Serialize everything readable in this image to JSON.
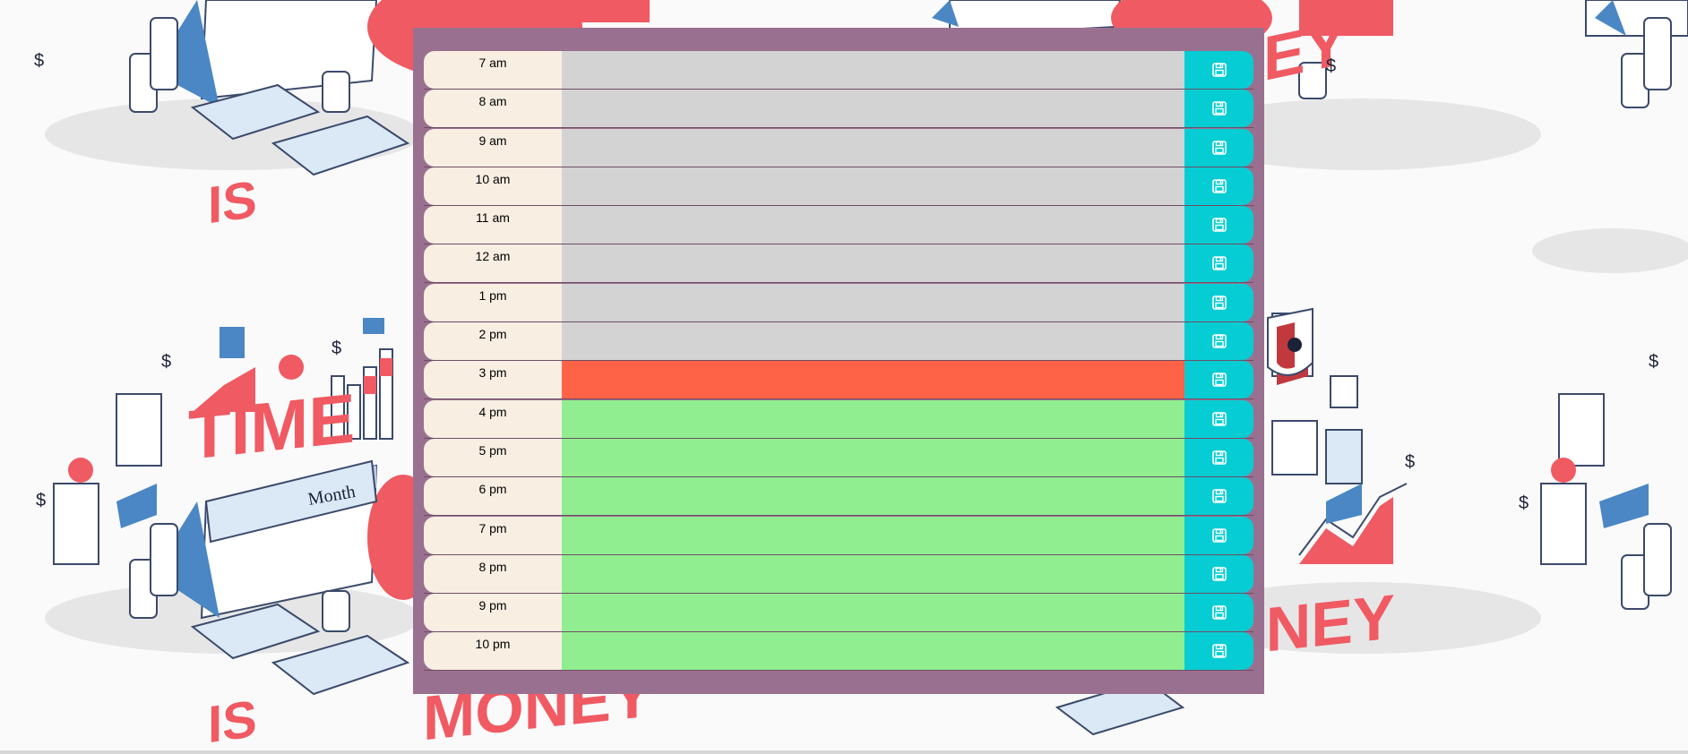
{
  "planner": {
    "rows": [
      {
        "hour": "7 am",
        "text": "",
        "state": "past"
      },
      {
        "hour": "8 am",
        "text": "",
        "state": "past"
      },
      {
        "hour": "9 am",
        "text": "",
        "state": "past"
      },
      {
        "hour": "10 am",
        "text": "",
        "state": "past"
      },
      {
        "hour": "11 am",
        "text": "",
        "state": "past"
      },
      {
        "hour": "12 am",
        "text": "",
        "state": "past"
      },
      {
        "hour": "1 pm",
        "text": "",
        "state": "past"
      },
      {
        "hour": "2 pm",
        "text": "",
        "state": "past"
      },
      {
        "hour": "3 pm",
        "text": "",
        "state": "present"
      },
      {
        "hour": "4 pm",
        "text": "",
        "state": "future"
      },
      {
        "hour": "5 pm",
        "text": "",
        "state": "future"
      },
      {
        "hour": "6 pm",
        "text": "",
        "state": "future"
      },
      {
        "hour": "7 pm",
        "text": "",
        "state": "future"
      },
      {
        "hour": "8 pm",
        "text": "",
        "state": "future"
      },
      {
        "hour": "9 pm",
        "text": "",
        "state": "future"
      },
      {
        "hour": "10 pm",
        "text": "",
        "state": "future"
      }
    ],
    "save_icon": "save-icon"
  },
  "wallpaper": {
    "texts": [
      "IS",
      "TIME",
      "MONEY",
      "Month"
    ]
  },
  "colors": {
    "frame": "#9a7090",
    "hour_bg": "#f8eee2",
    "past": "#d3d3d3",
    "present": "#ff6347",
    "future": "#90ee90",
    "save": "#06cdd3"
  }
}
